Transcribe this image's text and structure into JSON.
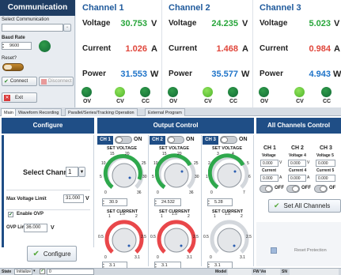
{
  "left": {
    "title": "Communication",
    "select_label": "Select Communication",
    "select_value": "",
    "baud_label": "Baud Rate",
    "baud_value": "9600",
    "reset_label": "Reset?",
    "connect_label": "Connect",
    "disconnect_label": "Disconnect",
    "exit_label": "Exit"
  },
  "channels": [
    {
      "name": "Channel 1",
      "voltage": "30.753",
      "current": "1.026",
      "power": "31.553",
      "indicators": [
        "OV",
        "CV",
        "CC"
      ]
    },
    {
      "name": "Channel 2",
      "voltage": "24.235",
      "current": "1.468",
      "power": "35.577",
      "indicators": [
        "OV",
        "CV",
        "CC"
      ]
    },
    {
      "name": "Channel 3",
      "voltage": "5.023",
      "current": "0.984",
      "power": "4.943",
      "indicators": [
        "OV",
        "CV",
        "CC"
      ]
    }
  ],
  "row_labels": {
    "voltage": "Voltage",
    "current": "Current",
    "power": "Power"
  },
  "units": {
    "voltage": "V",
    "current": "A",
    "power": "W"
  },
  "tabs": [
    "Main",
    "Waveform Recording",
    "Parallel/Series/Tracking Operation",
    "External Program"
  ],
  "configure": {
    "header": "Configure",
    "select_channel_label": "Select Channel",
    "select_channel_value": "1",
    "max_voltage_label": "Max Voltage Limit",
    "max_voltage_value": "31.000",
    "max_voltage_unit": "V",
    "enable_ovp_label": "Enable OVP",
    "ovp_limit_label": "OVP Limit",
    "ovp_limit_value": "36.000",
    "ovp_limit_unit": "V",
    "configure_button": "Configure"
  },
  "output": {
    "header": "Output Control",
    "channels": [
      {
        "tag": "CH 1",
        "on_label": "ON",
        "set_voltage_label": "SET VOLTAGE",
        "voltage_ticks": [
          "10",
          "15",
          "20",
          "25",
          "5",
          "30",
          "0",
          "36"
        ],
        "voltage_value": "30.9",
        "set_current_label": "SET CURRENT",
        "current_ticks": [
          "1",
          "1.5",
          "2",
          "0.5",
          "2.5",
          "0",
          "3.1"
        ],
        "current_value": "3.1"
      },
      {
        "tag": "CH 2",
        "on_label": "ON",
        "set_voltage_label": "SET VOLTAGE",
        "voltage_ticks": [
          "10",
          "15",
          "20",
          "25",
          "5",
          "30",
          "0",
          "36"
        ],
        "voltage_value": "24.532",
        "set_current_label": "SET CURRENT",
        "current_ticks": [
          "1",
          "1.5",
          "2",
          "0.5",
          "2.5",
          "0",
          "3.1"
        ],
        "current_value": "3.1"
      },
      {
        "tag": "CH 3",
        "on_label": "ON",
        "set_voltage_label": "SET VOLTAGE",
        "voltage_ticks": [
          "2",
          "3",
          "4",
          "5",
          "1",
          "6",
          "0",
          "7"
        ],
        "voltage_value": "5.28",
        "set_current_label": "SET CURRENT",
        "current_ticks": [
          "1",
          "1.5",
          "2",
          "0.5",
          "2.5",
          "0",
          "3.1"
        ],
        "current_value": "3.1"
      }
    ]
  },
  "allch": {
    "header": "All Channels Control",
    "columns": [
      {
        "name": "CH 1",
        "voltage_label": "Voltage",
        "voltage_value": "0.000",
        "voltage_unit": "V",
        "current_label": "Current",
        "current_value": "0.000",
        "current_unit": "A",
        "off_label": "OFF"
      },
      {
        "name": "CH 2",
        "voltage_label": "Voltage 4",
        "voltage_value": "0.000",
        "voltage_unit": "V",
        "current_label": "Current 4",
        "current_value": "0.000",
        "current_unit": "A",
        "off_label": "OFF"
      },
      {
        "name": "CH 3",
        "voltage_label": "Voltage 5",
        "voltage_value": "0.000",
        "voltage_unit": "",
        "current_label": "Current 5",
        "current_value": "0.000",
        "current_unit": "",
        "off_label": "OF"
      }
    ],
    "set_all_label": "Set All Channels",
    "reset_protection_label": "Reset Protection"
  },
  "status": {
    "state_label": "State",
    "state_value": "Initialize",
    "code_value": "0",
    "model_label": "Model",
    "fw_label": "FW Ver",
    "sn_label": "SN"
  },
  "colors": {
    "value_green": "#27a53a",
    "value_red": "#e0463b",
    "value_blue": "#1e73c8",
    "header_navy": "#1f4e86",
    "led_green": "#6dcc3c",
    "led_dark": "#136b36"
  }
}
